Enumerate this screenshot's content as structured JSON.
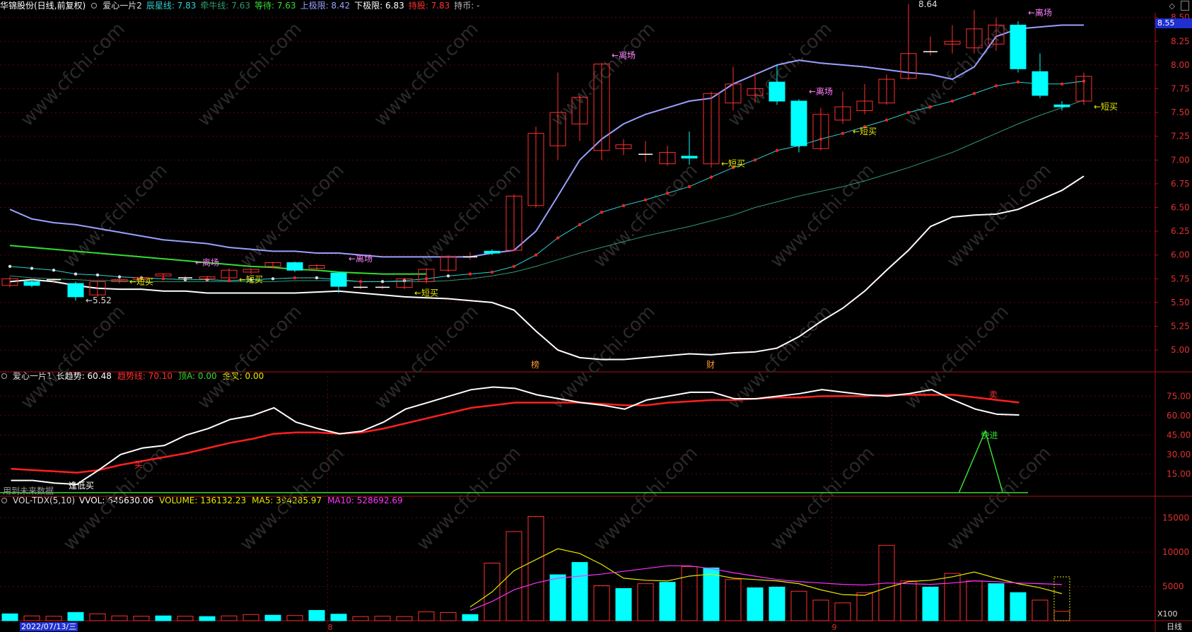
{
  "header_main": {
    "stock": "华锦股份(日线,前复权)",
    "indicator": "爱心一片2",
    "items": [
      {
        "label": "辰星线:",
        "value": "7.83",
        "color": "#2fd0d0"
      },
      {
        "label": "牵牛线:",
        "value": "7.63",
        "color": "#2f9a6f"
      },
      {
        "label": "等待:",
        "value": "7.63",
        "color": "#33dd33"
      },
      {
        "label": "上极限:",
        "value": "8.42",
        "color": "#9aa0ff"
      },
      {
        "label": "下极限:",
        "value": "6.83",
        "color": "#ffffff"
      },
      {
        "label": "持股:",
        "value": "7.83",
        "color": "#ff3030"
      },
      {
        "label": "持币:",
        "value": "-",
        "color": "#bbbbbb"
      }
    ]
  },
  "header_ind": {
    "indicator": "爱心一片1",
    "items": [
      {
        "label": "长趋势:",
        "value": "60.48",
        "color": "#ffffff"
      },
      {
        "label": "趋势线:",
        "value": "70.10",
        "color": "#ff3030"
      },
      {
        "label": "顶A:",
        "value": "0.00",
        "color": "#33dd33"
      },
      {
        "label": "金叉:",
        "value": "0.00",
        "color": "#e8e800"
      }
    ]
  },
  "header_vol": {
    "indicator": "VOL-TDX(5,10)",
    "items": [
      {
        "label": "VVOL:",
        "value": "648630.06",
        "color": "#ffffff"
      },
      {
        "label": "VOLUME:",
        "value": "136132.23",
        "color": "#e8e800"
      },
      {
        "label": "MA5:",
        "value": "394285.97",
        "color": "#e8e800"
      },
      {
        "label": "MA10:",
        "value": "528692.69",
        "color": "#ff33ff"
      }
    ]
  },
  "price_axis": {
    "ticks": [
      "8.50",
      "8.25",
      "8.00",
      "7.75",
      "7.50",
      "7.25",
      "7.00",
      "6.75",
      "6.50",
      "6.25",
      "6.00",
      "5.75",
      "5.50",
      "5.25",
      "5.00"
    ],
    "current": "8.55"
  },
  "ind_axis": {
    "ticks": [
      "75.00",
      "60.00",
      "45.00",
      "30.00",
      "15.00"
    ]
  },
  "vol_axis": {
    "ticks": [
      "15000",
      "10000",
      "5000"
    ],
    "unit": "X100"
  },
  "date_label": "2022/07/13/三",
  "month_labels": [
    "8",
    "9"
  ],
  "period": "日线",
  "watermark": "www.cfchi.com",
  "chart_data": {
    "type": "candlestick",
    "candles": [
      [
        5.68,
        5.75,
        5.66,
        5.77
      ],
      [
        5.72,
        5.68,
        5.66,
        5.74
      ],
      [
        5.74,
        5.74,
        5.7,
        5.76
      ],
      [
        5.7,
        5.56,
        5.52,
        5.72
      ],
      [
        5.58,
        5.72,
        5.56,
        5.73
      ],
      [
        5.72,
        5.74,
        5.7,
        5.75
      ],
      [
        5.74,
        5.76,
        5.72,
        5.78
      ],
      [
        5.78,
        5.8,
        5.76,
        5.81
      ],
      [
        5.76,
        5.76,
        5.74,
        5.78
      ],
      [
        5.75,
        5.77,
        5.72,
        5.78
      ],
      [
        5.76,
        5.84,
        5.74,
        5.86
      ],
      [
        5.82,
        5.85,
        5.8,
        5.86
      ],
      [
        5.88,
        5.92,
        5.86,
        5.93
      ],
      [
        5.92,
        5.84,
        5.82,
        5.93
      ],
      [
        5.86,
        5.89,
        5.84,
        5.9
      ],
      [
        5.81,
        5.67,
        5.6,
        5.82
      ],
      [
        5.66,
        5.66,
        5.64,
        5.7
      ],
      [
        5.66,
        5.66,
        5.64,
        5.68
      ],
      [
        5.66,
        5.75,
        5.64,
        5.76
      ],
      [
        5.72,
        5.85,
        5.7,
        5.86
      ],
      [
        5.84,
        5.98,
        5.82,
        6.0
      ],
      [
        5.97,
        5.98,
        5.95,
        6.03
      ],
      [
        6.04,
        6.02,
        6.0,
        6.06
      ],
      [
        6.05,
        6.62,
        6.04,
        6.64
      ],
      [
        6.52,
        7.28,
        6.5,
        7.35
      ],
      [
        7.15,
        7.5,
        7.0,
        7.92
      ],
      [
        7.38,
        7.66,
        7.2,
        7.68
      ],
      [
        7.1,
        8.01,
        7.0,
        8.02
      ],
      [
        7.12,
        7.16,
        7.05,
        7.22
      ],
      [
        7.06,
        7.06,
        6.98,
        7.2
      ],
      [
        6.96,
        7.08,
        6.94,
        7.15
      ],
      [
        7.04,
        7.02,
        6.95,
        7.3
      ],
      [
        6.96,
        7.7,
        6.92,
        7.72
      ],
      [
        7.6,
        7.8,
        7.52,
        7.98
      ],
      [
        7.68,
        7.75,
        7.6,
        7.92
      ],
      [
        7.82,
        7.62,
        7.58,
        8.0
      ],
      [
        7.62,
        7.15,
        7.08,
        7.64
      ],
      [
        7.12,
        7.48,
        7.1,
        7.55
      ],
      [
        7.42,
        7.56,
        7.38,
        7.72
      ],
      [
        7.52,
        7.62,
        7.48,
        7.8
      ],
      [
        7.6,
        7.85,
        7.58,
        7.9
      ],
      [
        7.86,
        8.12,
        7.84,
        8.64
      ],
      [
        8.14,
        8.14,
        8.1,
        8.3
      ],
      [
        8.22,
        8.25,
        8.12,
        8.42
      ],
      [
        8.18,
        8.38,
        8.12,
        8.58
      ],
      [
        8.22,
        8.42,
        8.15,
        8.5
      ],
      [
        8.42,
        7.96,
        7.92,
        8.46
      ],
      [
        7.93,
        7.68,
        7.65,
        8.12
      ],
      [
        7.58,
        7.56,
        7.52,
        7.62
      ],
      [
        7.62,
        7.88,
        7.58,
        7.92
      ]
    ],
    "upper_limit": [
      6.48,
      6.38,
      6.34,
      6.32,
      6.28,
      6.24,
      6.2,
      6.16,
      6.14,
      6.12,
      6.08,
      6.06,
      6.04,
      6.04,
      6.02,
      6.02,
      6.0,
      5.98,
      5.98,
      5.98,
      5.98,
      5.98,
      6.02,
      6.05,
      6.25,
      6.62,
      7.0,
      7.22,
      7.38,
      7.48,
      7.55,
      7.62,
      7.65,
      7.8,
      7.9,
      8.0,
      8.05,
      8.02,
      8.0,
      7.98,
      7.95,
      7.92,
      7.9,
      7.85,
      7.98,
      8.3,
      8.38,
      8.4,
      8.42,
      8.42
    ],
    "lower_limit": [
      5.72,
      5.74,
      5.72,
      5.68,
      5.65,
      5.64,
      5.64,
      5.62,
      5.62,
      5.6,
      5.6,
      5.6,
      5.6,
      5.6,
      5.61,
      5.62,
      5.6,
      5.58,
      5.56,
      5.55,
      5.54,
      5.52,
      5.5,
      5.42,
      5.2,
      5.0,
      4.92,
      4.9,
      4.9,
      4.92,
      4.94,
      4.96,
      4.95,
      4.97,
      4.98,
      5.02,
      5.14,
      5.3,
      5.44,
      5.62,
      5.84,
      6.05,
      6.3,
      6.4,
      6.42,
      6.43,
      6.48,
      6.58,
      6.68,
      6.83
    ],
    "star_line": [
      5.88,
      5.86,
      5.84,
      5.8,
      5.79,
      5.77,
      5.76,
      5.75,
      5.74,
      5.74,
      5.73,
      5.74,
      5.75,
      5.76,
      5.76,
      5.74,
      5.72,
      5.72,
      5.73,
      5.75,
      5.78,
      5.8,
      5.82,
      5.88,
      6.0,
      6.18,
      6.32,
      6.45,
      6.52,
      6.58,
      6.65,
      6.72,
      6.82,
      6.92,
      7.0,
      7.1,
      7.15,
      7.22,
      7.28,
      7.35,
      7.42,
      7.5,
      7.56,
      7.62,
      7.7,
      7.78,
      7.82,
      7.8,
      7.8,
      7.83
    ],
    "cow_line": [
      5.78,
      5.76,
      5.75,
      5.74,
      5.73,
      5.73,
      5.72,
      5.72,
      5.72,
      5.72,
      5.72,
      5.72,
      5.72,
      5.73,
      5.73,
      5.73,
      5.72,
      5.72,
      5.72,
      5.72,
      5.73,
      5.75,
      5.78,
      5.82,
      5.88,
      5.95,
      6.02,
      6.08,
      6.14,
      6.2,
      6.25,
      6.3,
      6.36,
      6.42,
      6.5,
      6.56,
      6.62,
      6.67,
      6.72,
      6.78,
      6.85,
      6.92,
      7.0,
      7.08,
      7.18,
      7.28,
      7.38,
      7.47,
      7.55,
      7.63
    ],
    "wait_line": [
      6.1,
      6.08,
      6.06,
      6.04,
      6.02,
      6.0,
      5.98,
      5.96,
      5.94,
      5.92,
      5.9,
      5.88,
      5.87,
      5.85,
      5.84,
      5.82,
      5.81,
      5.8,
      5.8,
      5.8
    ],
    "ind_long": [
      10,
      10,
      8,
      7,
      18,
      30,
      35,
      37,
      45,
      50,
      57,
      60,
      66,
      55,
      50,
      46,
      48,
      55,
      65,
      70,
      75,
      80,
      82,
      81,
      76,
      73,
      70,
      68,
      65,
      72,
      75,
      78,
      78,
      73,
      73,
      75,
      77,
      80,
      78,
      76,
      75,
      77,
      80,
      72,
      65,
      61,
      60.48
    ],
    "ind_trend": [
      19,
      18,
      17,
      16,
      18,
      22,
      25,
      28,
      31,
      35,
      39,
      42,
      46,
      47,
      47,
      46,
      47,
      50,
      54,
      58,
      62,
      66,
      68,
      70,
      70,
      70,
      70,
      69,
      68,
      68,
      70,
      71,
      72,
      72,
      73,
      74,
      74,
      75,
      75,
      75,
      76,
      76,
      76,
      76,
      74,
      72,
      70.1
    ],
    "ind_spike": {
      "label": "快进",
      "value": 48
    },
    "volume": [
      [
        1,
        1000
      ],
      [
        0,
        700
      ],
      [
        0,
        650
      ],
      [
        1,
        1200
      ],
      [
        0,
        1000
      ],
      [
        0,
        700
      ],
      [
        0,
        650
      ],
      [
        1,
        700
      ],
      [
        0,
        650
      ],
      [
        1,
        600
      ],
      [
        0,
        700
      ],
      [
        0,
        900
      ],
      [
        1,
        800
      ],
      [
        0,
        750
      ],
      [
        1,
        1500
      ],
      [
        1,
        950
      ],
      [
        0,
        600
      ],
      [
        0,
        650
      ],
      [
        0,
        600
      ],
      [
        0,
        1300
      ],
      [
        0,
        1200
      ],
      [
        1,
        900
      ],
      [
        0,
        8400
      ],
      [
        0,
        13000
      ],
      [
        0,
        15200
      ],
      [
        1,
        6700
      ],
      [
        1,
        8500
      ],
      [
        0,
        5100
      ],
      [
        1,
        4700
      ],
      [
        0,
        5400
      ],
      [
        1,
        5600
      ],
      [
        0,
        7900
      ],
      [
        1,
        7700
      ],
      [
        0,
        6000
      ],
      [
        1,
        4800
      ],
      [
        1,
        4900
      ],
      [
        0,
        4300
      ],
      [
        0,
        3000
      ],
      [
        0,
        2600
      ],
      [
        0,
        4100
      ],
      [
        0,
        11000
      ],
      [
        0,
        5800
      ],
      [
        1,
        4900
      ],
      [
        0,
        6900
      ],
      [
        0,
        5800
      ],
      [
        1,
        5400
      ],
      [
        1,
        4100
      ],
      [
        0,
        3000
      ],
      [
        0,
        1361
      ]
    ],
    "vol_ma5": [
      null,
      null,
      null,
      null,
      null,
      null,
      null,
      null,
      null,
      null,
      null,
      null,
      null,
      null,
      null,
      null,
      null,
      null,
      null,
      null,
      null,
      2000,
      4200,
      7300,
      8900,
      10500,
      9800,
      8200,
      6200,
      5900,
      5800,
      6500,
      6800,
      6200,
      6000,
      5800,
      5400,
      4500,
      3800,
      3700,
      4800,
      5700,
      5900,
      6400,
      7100,
      6200,
      5400,
      4800,
      3943
    ],
    "vol_ma10": [
      null,
      null,
      null,
      null,
      null,
      null,
      null,
      null,
      null,
      null,
      null,
      null,
      null,
      null,
      null,
      null,
      null,
      null,
      null,
      null,
      null,
      1500,
      2800,
      4500,
      5500,
      6200,
      6500,
      6800,
      7200,
      7600,
      8000,
      8000,
      7600,
      7000,
      6500,
      6000,
      5700,
      5500,
      5300,
      5200,
      5500,
      5400,
      5300,
      5500,
      5800,
      5700,
      5500,
      5400,
      5287
    ],
    "annotations": [
      {
        "text": "←5.52",
        "i": 3,
        "price": 5.52,
        "color": "#dddddd"
      },
      {
        "text": "←短买",
        "i": 5,
        "price": 5.72,
        "color": "#e8e800"
      },
      {
        "text": "←离场",
        "i": 8,
        "price": 5.92,
        "color": "#ff80ff"
      },
      {
        "text": "←短买",
        "i": 10,
        "price": 5.74,
        "color": "#e8e800"
      },
      {
        "text": "←离场",
        "i": 15,
        "price": 5.96,
        "color": "#ff80ff"
      },
      {
        "text": "←短买",
        "i": 18,
        "price": 5.6,
        "color": "#e8e800"
      },
      {
        "text": "←离场",
        "i": 27,
        "price": 8.1,
        "color": "#ff80ff"
      },
      {
        "text": "←短买",
        "i": 32,
        "price": 6.96,
        "color": "#e8e800"
      },
      {
        "text": "←离场",
        "i": 36,
        "price": 7.72,
        "color": "#ff80ff"
      },
      {
        "text": "←短买",
        "i": 38,
        "price": 7.3,
        "color": "#e8e800"
      },
      {
        "text": "8.64",
        "i": 41,
        "price": 8.64,
        "color": "#dddddd"
      },
      {
        "text": "←离场",
        "i": 46,
        "price": 8.55,
        "color": "#ff80ff"
      },
      {
        "text": "←短买",
        "i": 49,
        "price": 7.56,
        "color": "#e8e800"
      }
    ],
    "ind_labels": [
      {
        "text": "逢低买",
        "i": 3,
        "value": 6,
        "color": "#ffffff"
      },
      {
        "text": "买",
        "i": 6,
        "value": 22,
        "color": "#ff3030"
      },
      {
        "text": "卖",
        "i": 45,
        "value": 76,
        "color": "#ff3030"
      },
      {
        "text": "用到未来数据",
        "i": 0,
        "value": 2,
        "color": "#999999"
      }
    ],
    "markers": [
      {
        "text": "榜",
        "i": 24
      },
      {
        "text": "财",
        "i": 32
      }
    ]
  }
}
